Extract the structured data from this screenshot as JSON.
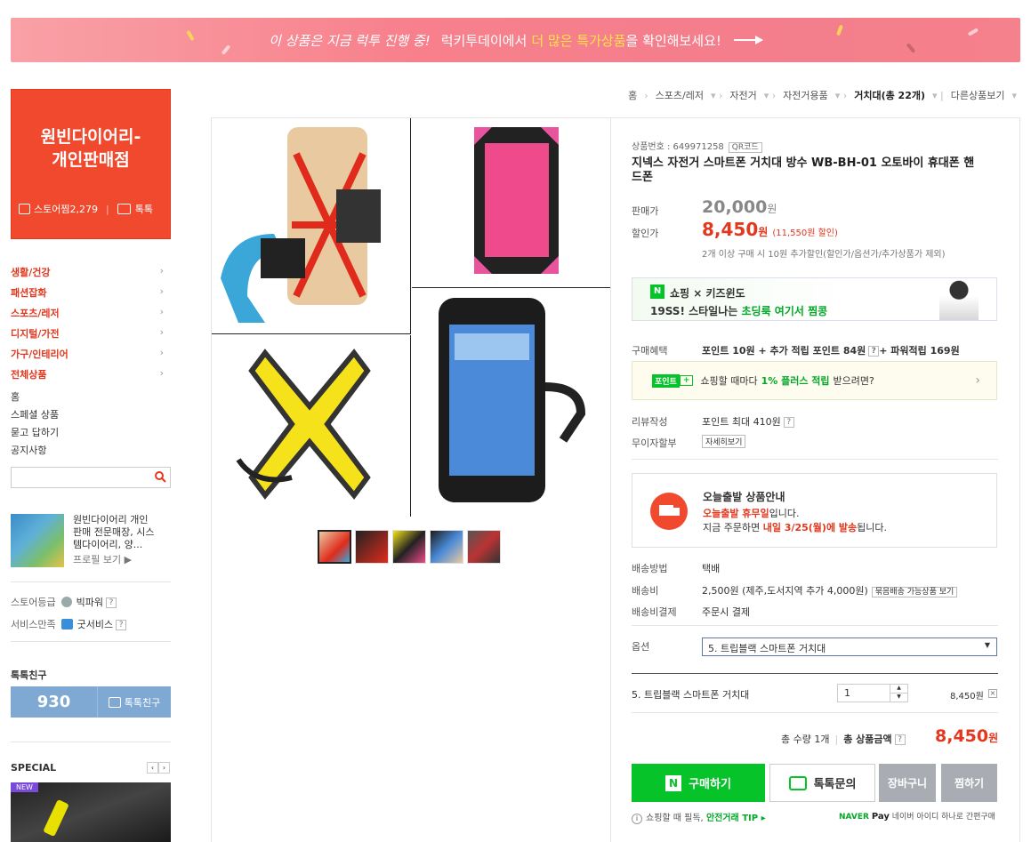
{
  "banner": {
    "t1": "이 상품은 지금 럭투 진행 중!",
    "t2": "럭키투데이에서",
    "t3": "더 많은 특가상품",
    "t4": "을 확인해보세요!"
  },
  "store": {
    "name1": "원빈다이어리-",
    "name2": "개인판매점",
    "jjim": "스토어찜2,279",
    "talk": "톡톡"
  },
  "categories": [
    "생활/건강",
    "패션잡화",
    "스포츠/레저",
    "디지털/가전",
    "가구/인테리어",
    "전체상품"
  ],
  "menu": [
    "홈",
    "스페셜 상품",
    "묻고 답하기",
    "공지사항"
  ],
  "search": {
    "placeholder": ""
  },
  "profile": {
    "desc1": "원빈다이어리 개인",
    "desc2": "판매 전문매장, 시스",
    "desc3": "템다이어리, 양...",
    "more": "프로필 보기 ▶"
  },
  "grade": {
    "label": "스토어등급",
    "value": "빅파워"
  },
  "service": {
    "label": "서비스만족",
    "value": "굿서비스"
  },
  "talkfriend": {
    "title": "톡톡친구",
    "count": "930",
    "btn": "톡톡친구"
  },
  "special": {
    "title": "SPECIAL",
    "badge": "NEW"
  },
  "breadcrumb": [
    "홈",
    "스포츠/레저",
    "자전거",
    "자전거용품"
  ],
  "breadcrumb_last": "거치대(총 22개)",
  "breadcrumb_more": "다른상품보기",
  "product": {
    "number": "상품번호 : 649971258",
    "qr": "QR코드",
    "title1": "지넥스 자전거 스마트폰 거치대 방수 WB-BH-01 오토바이 휴대폰 핸",
    "title2": "드폰",
    "price_label": "판매가",
    "price": "20,000",
    "won": "원",
    "sale_label": "할인가",
    "sale": "8,450",
    "sale_won": "원",
    "sale_note": "(11,550원 할인)",
    "multi_note": "2개 이상 구매 시 10원 추가할인(할인가/옵션가/추가상품가 제외)"
  },
  "ad": {
    "brand": "쇼핑 × 키즈윈도",
    "line2a": "19SS! 스타일나는",
    "line2b": "초딩룩 여기서 찜콩"
  },
  "benefit": {
    "label": "구매혜택",
    "text": "포인트 10원 + 추가 적립 포인트 84원",
    "plus": "+ 파워적립  169원"
  },
  "point": {
    "badge": "포인트",
    "t1": "쇼핑할 때마다",
    "t2": "1% 플러스 적립",
    "t3": "받으려면?"
  },
  "review": {
    "label": "리뷰작성",
    "text": "포인트 최대 410원"
  },
  "installment": {
    "label": "무이자할부",
    "btn": "자세히보기"
  },
  "today": {
    "title": "오늘출발 상품안내",
    "red": "오늘출발 휴무일",
    "rest": "입니다.",
    "l3a": "지금 주문하면",
    "l3b": "내일 3/25(월)에 발송",
    "l3c": "됩니다."
  },
  "shipping": {
    "m_label": "배송방법",
    "m_val": "택배",
    "c_label": "배송비",
    "c_val": "2,500원 (제주,도서지역 추가 4,000원)",
    "c_btn": "묶음배송 가능상품 보기",
    "p_label": "배송비결제",
    "p_val": "주문시 결제"
  },
  "option": {
    "label": "옵션",
    "value": "5. 트립블랙 스마트폰 거치대"
  },
  "selected": {
    "name": "5. 트립블랙 스마트폰 거치대",
    "qty": "1",
    "price": "8,450원"
  },
  "total": {
    "qty": "총 수량 1개",
    "label": "총 상품금액",
    "amount": "8,450",
    "won": "원"
  },
  "buttons": {
    "buy": "구매하기",
    "talk": "톡톡문의",
    "cart": "장바구니",
    "wish": "찜하기"
  },
  "footer": {
    "safe1": "쇼핑할 때 필독,",
    "safe2": "안전거래 TIP ▸",
    "naver1": "NAVER",
    "naver2": "Pay",
    "naver3": "네이버 아이디 하나로 간편구매"
  },
  "colors": {
    "accent": "#f0492e",
    "green": "#05c328",
    "red": "#e3371e"
  }
}
